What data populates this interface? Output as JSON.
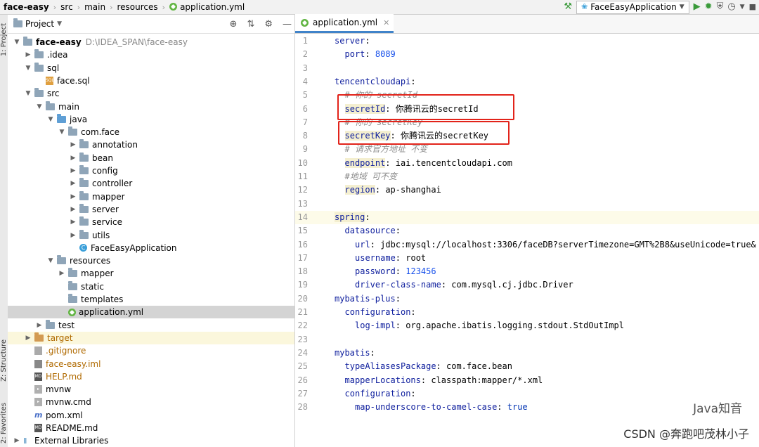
{
  "breadcrumb": [
    "face-easy",
    "src",
    "main",
    "resources",
    "application.yml"
  ],
  "run_config": "FaceEasyApplication",
  "side_tabs": {
    "project": "1: Project",
    "structure": "Z: Structure",
    "favorites": "2: Favorites"
  },
  "project_panel": {
    "title": "Project",
    "tree": [
      {
        "label": "face-easy",
        "extra": "D:\\IDEA_SPAN\\face-easy",
        "level": 0,
        "arrow": "down",
        "icon": "module",
        "bold": true
      },
      {
        "label": ".idea",
        "level": 1,
        "arrow": "right",
        "icon": "folder"
      },
      {
        "label": "sql",
        "level": 1,
        "arrow": "down",
        "icon": "folder"
      },
      {
        "label": "face.sql",
        "level": 2,
        "arrow": "none",
        "icon": "sql"
      },
      {
        "label": "src",
        "level": 1,
        "arrow": "down",
        "icon": "folder"
      },
      {
        "label": "main",
        "level": 2,
        "arrow": "down",
        "icon": "folder"
      },
      {
        "label": "java",
        "level": 3,
        "arrow": "down",
        "icon": "folder-blue"
      },
      {
        "label": "com.face",
        "level": 4,
        "arrow": "down",
        "icon": "folder"
      },
      {
        "label": "annotation",
        "level": 5,
        "arrow": "right",
        "icon": "folder"
      },
      {
        "label": "bean",
        "level": 5,
        "arrow": "right",
        "icon": "folder"
      },
      {
        "label": "config",
        "level": 5,
        "arrow": "right",
        "icon": "folder"
      },
      {
        "label": "controller",
        "level": 5,
        "arrow": "right",
        "icon": "folder"
      },
      {
        "label": "mapper",
        "level": 5,
        "arrow": "right",
        "icon": "folder"
      },
      {
        "label": "server",
        "level": 5,
        "arrow": "right",
        "icon": "folder"
      },
      {
        "label": "service",
        "level": 5,
        "arrow": "right",
        "icon": "folder"
      },
      {
        "label": "utils",
        "level": 5,
        "arrow": "right",
        "icon": "folder"
      },
      {
        "label": "FaceEasyApplication",
        "level": 5,
        "arrow": "none",
        "icon": "class"
      },
      {
        "label": "resources",
        "level": 3,
        "arrow": "down",
        "icon": "folder"
      },
      {
        "label": "mapper",
        "level": 4,
        "arrow": "right",
        "icon": "folder"
      },
      {
        "label": "static",
        "level": 4,
        "arrow": "none",
        "icon": "folder"
      },
      {
        "label": "templates",
        "level": 4,
        "arrow": "none",
        "icon": "folder"
      },
      {
        "label": "application.yml",
        "level": 4,
        "arrow": "none",
        "icon": "yml",
        "selected": true
      },
      {
        "label": "test",
        "level": 2,
        "arrow": "right",
        "icon": "folder"
      },
      {
        "label": "target",
        "level": 1,
        "arrow": "right",
        "icon": "folder-orange",
        "highlight": true,
        "orange": true
      },
      {
        "label": ".gitignore",
        "level": 1,
        "arrow": "none",
        "icon": "git",
        "orange": true
      },
      {
        "label": "face-easy.iml",
        "level": 1,
        "arrow": "none",
        "icon": "iml",
        "orange": true
      },
      {
        "label": "HELP.md",
        "level": 1,
        "arrow": "none",
        "icon": "md",
        "orange": true
      },
      {
        "label": "mvnw",
        "level": 1,
        "arrow": "none",
        "icon": "file"
      },
      {
        "label": "mvnw.cmd",
        "level": 1,
        "arrow": "none",
        "icon": "file"
      },
      {
        "label": "pom.xml",
        "level": 1,
        "arrow": "none",
        "icon": "xml"
      },
      {
        "label": "README.md",
        "level": 1,
        "arrow": "none",
        "icon": "md"
      },
      {
        "label": "External Libraries",
        "level": 0,
        "arrow": "right",
        "icon": "lib"
      }
    ]
  },
  "editor": {
    "tab_label": "application.yml",
    "current_line": 14,
    "lines": [
      {
        "n": 1,
        "indent": 0,
        "key": "server",
        "val": ""
      },
      {
        "n": 2,
        "indent": 1,
        "key": "port",
        "val": "8089",
        "vclass": "n"
      },
      {
        "n": 3,
        "indent": 0
      },
      {
        "n": 4,
        "indent": 0,
        "key": "tencentcloudapi",
        "val": ""
      },
      {
        "n": 5,
        "indent": 1,
        "comment": "# 你的 secretId"
      },
      {
        "n": 6,
        "indent": 1,
        "key": "secretId",
        "val": "你腾讯云的secretId",
        "khl": true
      },
      {
        "n": 7,
        "indent": 1,
        "comment": "# 你的 secretKey"
      },
      {
        "n": 8,
        "indent": 1,
        "key": "secretKey",
        "val": "你腾讯云的secretKey",
        "khl": true
      },
      {
        "n": 9,
        "indent": 1,
        "comment": "# 请求官方地址 不变"
      },
      {
        "n": 10,
        "indent": 1,
        "key": "endpoint",
        "val": "iai.tencentcloudapi.com",
        "khl": true
      },
      {
        "n": 11,
        "indent": 1,
        "comment": "#地域 可不变"
      },
      {
        "n": 12,
        "indent": 1,
        "key": "region",
        "val": "ap-shanghai",
        "khl": true
      },
      {
        "n": 13,
        "indent": 0
      },
      {
        "n": 14,
        "indent": 0,
        "key": "spring",
        "val": "",
        "khl": true
      },
      {
        "n": 15,
        "indent": 1,
        "key": "datasource",
        "val": ""
      },
      {
        "n": 16,
        "indent": 2,
        "key": "url",
        "val": "jdbc:mysql://localhost:3306/faceDB?serverTimezone=GMT%2B8&useUnicode=true&"
      },
      {
        "n": 17,
        "indent": 2,
        "key": "username",
        "val": "root"
      },
      {
        "n": 18,
        "indent": 2,
        "key": "password",
        "val": "123456",
        "vclass": "n"
      },
      {
        "n": 19,
        "indent": 2,
        "key": "driver-class-name",
        "val": "com.mysql.cj.jdbc.Driver"
      },
      {
        "n": 20,
        "indent": 0,
        "key": "mybatis-plus",
        "val": ""
      },
      {
        "n": 21,
        "indent": 1,
        "key": "configuration",
        "val": ""
      },
      {
        "n": 22,
        "indent": 2,
        "key": "log-impl",
        "val": "org.apache.ibatis.logging.stdout.StdOutImpl"
      },
      {
        "n": 23,
        "indent": 0
      },
      {
        "n": 24,
        "indent": 0,
        "key": "mybatis",
        "val": ""
      },
      {
        "n": 25,
        "indent": 1,
        "key": "typeAliasesPackage",
        "val": "com.face.bean"
      },
      {
        "n": 26,
        "indent": 1,
        "key": "mapperLocations",
        "val": "classpath:mapper/*.xml"
      },
      {
        "n": 27,
        "indent": 1,
        "key": "configuration",
        "val": ""
      },
      {
        "n": 28,
        "indent": 2,
        "key": "map-underscore-to-camel-case",
        "val": "true",
        "vclass": "boolv"
      }
    ]
  },
  "watermark": {
    "line1": "Java知音",
    "line2": "CSDN @奔跑吧茂林小子"
  }
}
